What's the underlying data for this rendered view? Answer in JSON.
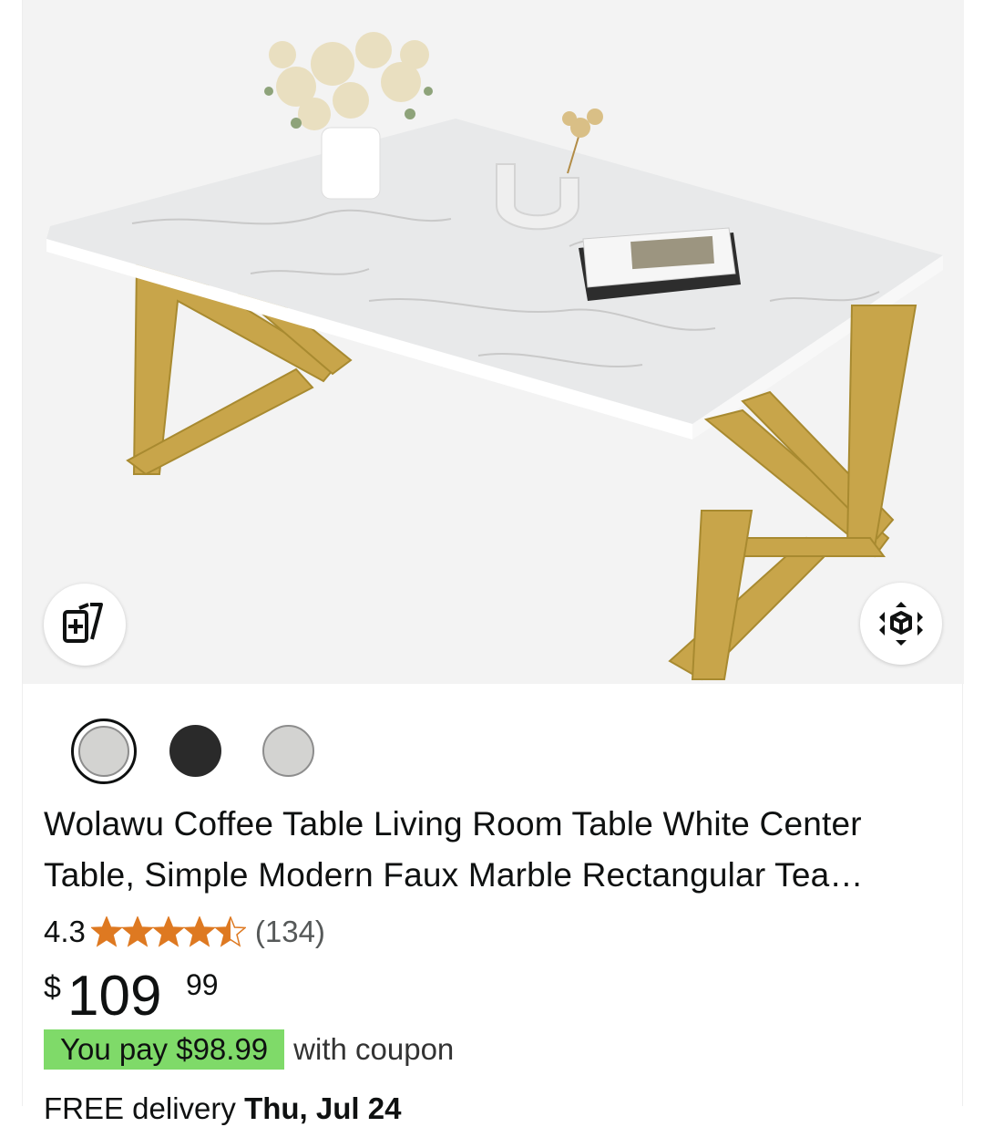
{
  "product": {
    "image_alt": "White marble coffee table with gold Z-shaped legs",
    "title_line1": "Wolawu Coffee Table Living Room Table White Center",
    "title_line2": "Table, Simple Modern Faux Marble Rectangular Tea…",
    "rating": "4.3",
    "rating_value": 4.3,
    "rating_count": "(134)",
    "price_symbol": "$",
    "price_whole": "109",
    "price_fraction": "99",
    "coupon_text": "You pay $98.99",
    "coupon_suffix": "with coupon",
    "delivery_prefix": "FREE delivery",
    "delivery_date": "Thu, Jul 24"
  },
  "swatches": [
    {
      "name": "white",
      "color": "#d3d3d1",
      "selected": true
    },
    {
      "name": "black",
      "color": "#2a2a2a",
      "selected": false
    },
    {
      "name": "grey",
      "color": "#d3d3d1",
      "selected": false
    }
  ],
  "icons": {
    "compare": "compare-cards-icon",
    "view_in_room": "ar-cube-icon",
    "star": "star-icon"
  },
  "colors": {
    "star": "#de7921",
    "coupon_bg": "#7fda69",
    "text": "#0f1111",
    "muted": "#565959"
  }
}
